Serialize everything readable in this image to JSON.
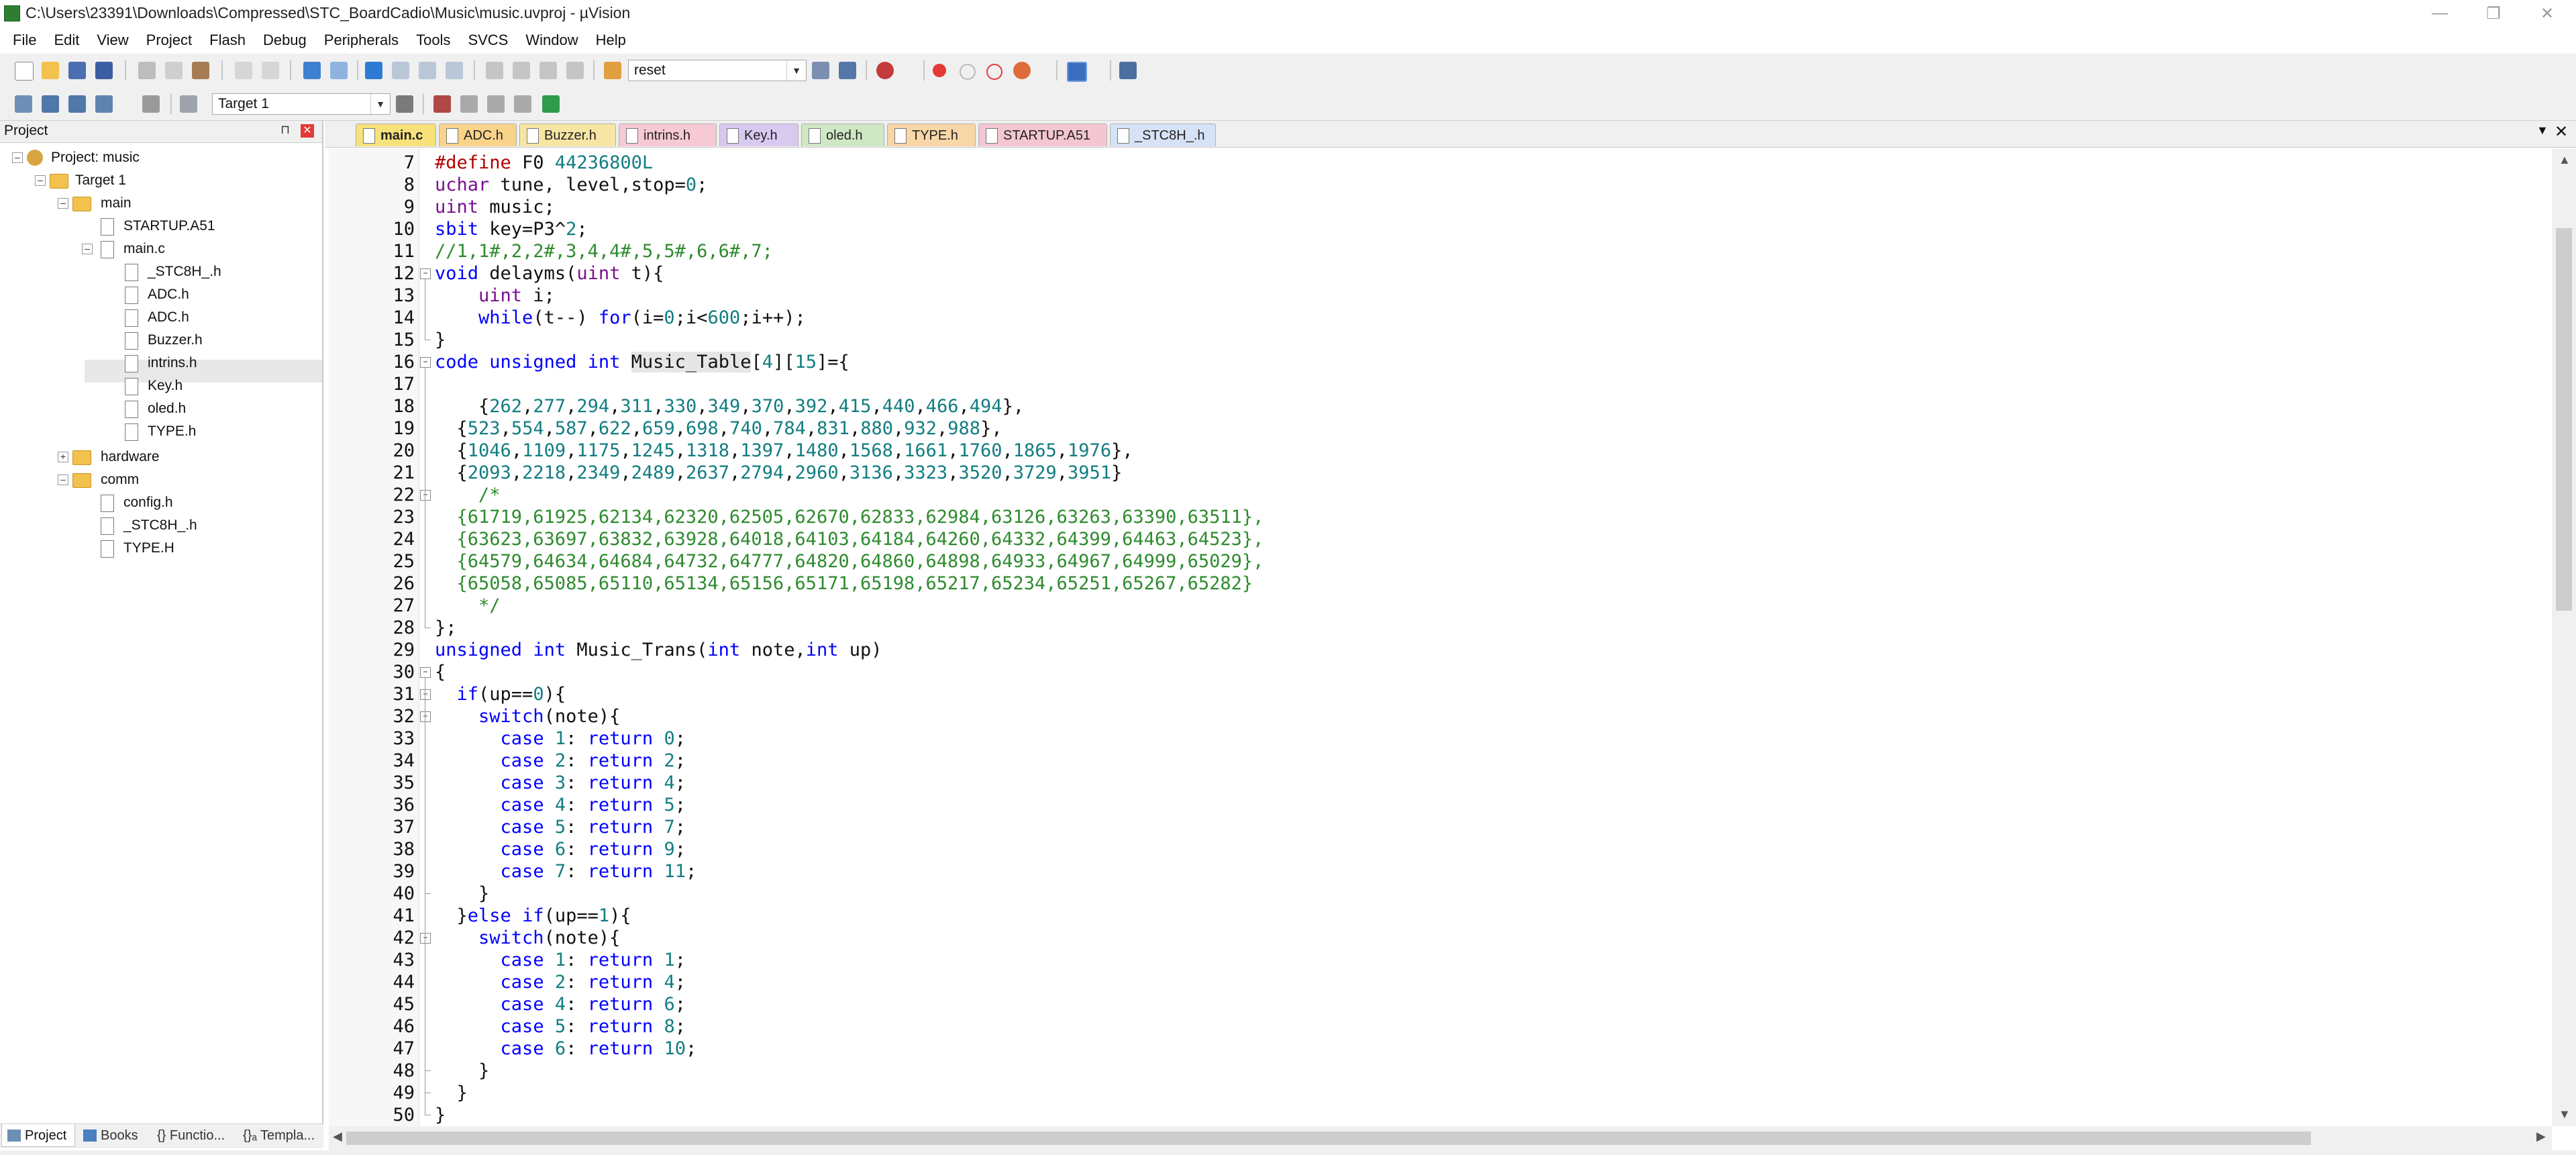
{
  "window": {
    "title": "C:\\Users\\23391\\Downloads\\Compressed\\STC_BoardCadio\\Music\\music.uvproj - µVision"
  },
  "menu": [
    "File",
    "Edit",
    "View",
    "Project",
    "Flash",
    "Debug",
    "Peripherals",
    "Tools",
    "SVCS",
    "Window",
    "Help"
  ],
  "toolbar": {
    "find_combo_value": "reset",
    "target_combo_value": "Target 1"
  },
  "project_panel": {
    "title": "Project",
    "pin_glyph": "⊓",
    "close_glyph": "✕",
    "tree": {
      "root": "Project: music",
      "target": "Target 1",
      "group_main": "main",
      "main_files": [
        "STARTUP.A51",
        "main.c"
      ],
      "main_c_includes": [
        "_STC8H_.h",
        "ADC.h",
        "ADC.h",
        "Buzzer.h",
        "intrins.h",
        "Key.h",
        "oled.h",
        "TYPE.h"
      ],
      "group_hardware": "hardware",
      "group_comm": "comm",
      "comm_files": [
        "config.h",
        "_STC8H_.h",
        "TYPE.H"
      ]
    },
    "bottom_tabs": [
      "Project",
      "Books",
      "{} Functio...",
      "{}ₐ Templa..."
    ]
  },
  "editor_tabs": [
    {
      "label": "main.c",
      "color": "#f7e27a"
    },
    {
      "label": "ADC.h",
      "color": "#f9d38a"
    },
    {
      "label": "Buzzer.h",
      "color": "#f7e6a3"
    },
    {
      "label": "intrins.h",
      "color": "#f6c9d4"
    },
    {
      "label": "Key.h",
      "color": "#d8c9f0"
    },
    {
      "label": "oled.h",
      "color": "#cfe8c4"
    },
    {
      "label": "TYPE.h",
      "color": "#f9d6a6"
    },
    {
      "label": "STARTUP.A51",
      "color": "#f4c6d2"
    },
    {
      "label": "_STC8H_.h",
      "color": "#d6e2f5"
    }
  ],
  "editor": {
    "lines": [
      {
        "n": "7",
        "t": "#define F0 44236800L"
      },
      {
        "n": "8",
        "t": "uchar tune, level,stop=0;"
      },
      {
        "n": "9",
        "t": "uint music;"
      },
      {
        "n": "10",
        "t": "sbit key=P3^2;"
      },
      {
        "n": "11",
        "t": "//1,1#,2,2#,3,4,4#,5,5#,6,6#,7;"
      },
      {
        "n": "12",
        "t": "void delayms(uint t){"
      },
      {
        "n": "13",
        "t": "    uint i;"
      },
      {
        "n": "14",
        "t": "    while(t--) for(i=0;i<600;i++);"
      },
      {
        "n": "15",
        "t": "}"
      },
      {
        "n": "16",
        "t": "code unsigned int Music_Table[4][15]={"
      },
      {
        "n": "17",
        "t": ""
      },
      {
        "n": "18",
        "t": "    {262,277,294,311,330,349,370,392,415,440,466,494},"
      },
      {
        "n": "19",
        "t": "  {523,554,587,622,659,698,740,784,831,880,932,988},"
      },
      {
        "n": "20",
        "t": "  {1046,1109,1175,1245,1318,1397,1480,1568,1661,1760,1865,1976},"
      },
      {
        "n": "21",
        "t": "  {2093,2218,2349,2489,2637,2794,2960,3136,3323,3520,3729,3951}"
      },
      {
        "n": "22",
        "t": "    /*"
      },
      {
        "n": "23",
        "t": "  {61719,61925,62134,62320,62505,62670,62833,62984,63126,63263,63390,63511},"
      },
      {
        "n": "24",
        "t": "  {63623,63697,63832,63928,64018,64103,64184,64260,64332,64399,64463,64523},"
      },
      {
        "n": "25",
        "t": "  {64579,64634,64684,64732,64777,64820,64860,64898,64933,64967,64999,65029},"
      },
      {
        "n": "26",
        "t": "  {65058,65085,65110,65134,65156,65171,65198,65217,65234,65251,65267,65282}"
      },
      {
        "n": "27",
        "t": "    */"
      },
      {
        "n": "28",
        "t": "};"
      },
      {
        "n": "29",
        "t": "unsigned int Music_Trans(int note,int up)"
      },
      {
        "n": "30",
        "t": "{"
      },
      {
        "n": "31",
        "t": "  if(up==0){"
      },
      {
        "n": "32",
        "t": "    switch(note){"
      },
      {
        "n": "33",
        "t": "      case 1: return 0;"
      },
      {
        "n": "34",
        "t": "      case 2: return 2;"
      },
      {
        "n": "35",
        "t": "      case 3: return 4;"
      },
      {
        "n": "36",
        "t": "      case 4: return 5;"
      },
      {
        "n": "37",
        "t": "      case 5: return 7;"
      },
      {
        "n": "38",
        "t": "      case 6: return 9;"
      },
      {
        "n": "39",
        "t": "      case 7: return 11;"
      },
      {
        "n": "40",
        "t": "    }"
      },
      {
        "n": "41",
        "t": "  }else if(up==1){"
      },
      {
        "n": "42",
        "t": "    switch(note){"
      },
      {
        "n": "43",
        "t": "      case 1: return 1;"
      },
      {
        "n": "44",
        "t": "      case 2: return 4;"
      },
      {
        "n": "45",
        "t": "      case 4: return 6;"
      },
      {
        "n": "46",
        "t": "      case 5: return 8;"
      },
      {
        "n": "47",
        "t": "      case 6: return 10;"
      },
      {
        "n": "48",
        "t": "    }"
      },
      {
        "n": "49",
        "t": "  }"
      },
      {
        "n": "50",
        "t": "}"
      }
    ]
  }
}
